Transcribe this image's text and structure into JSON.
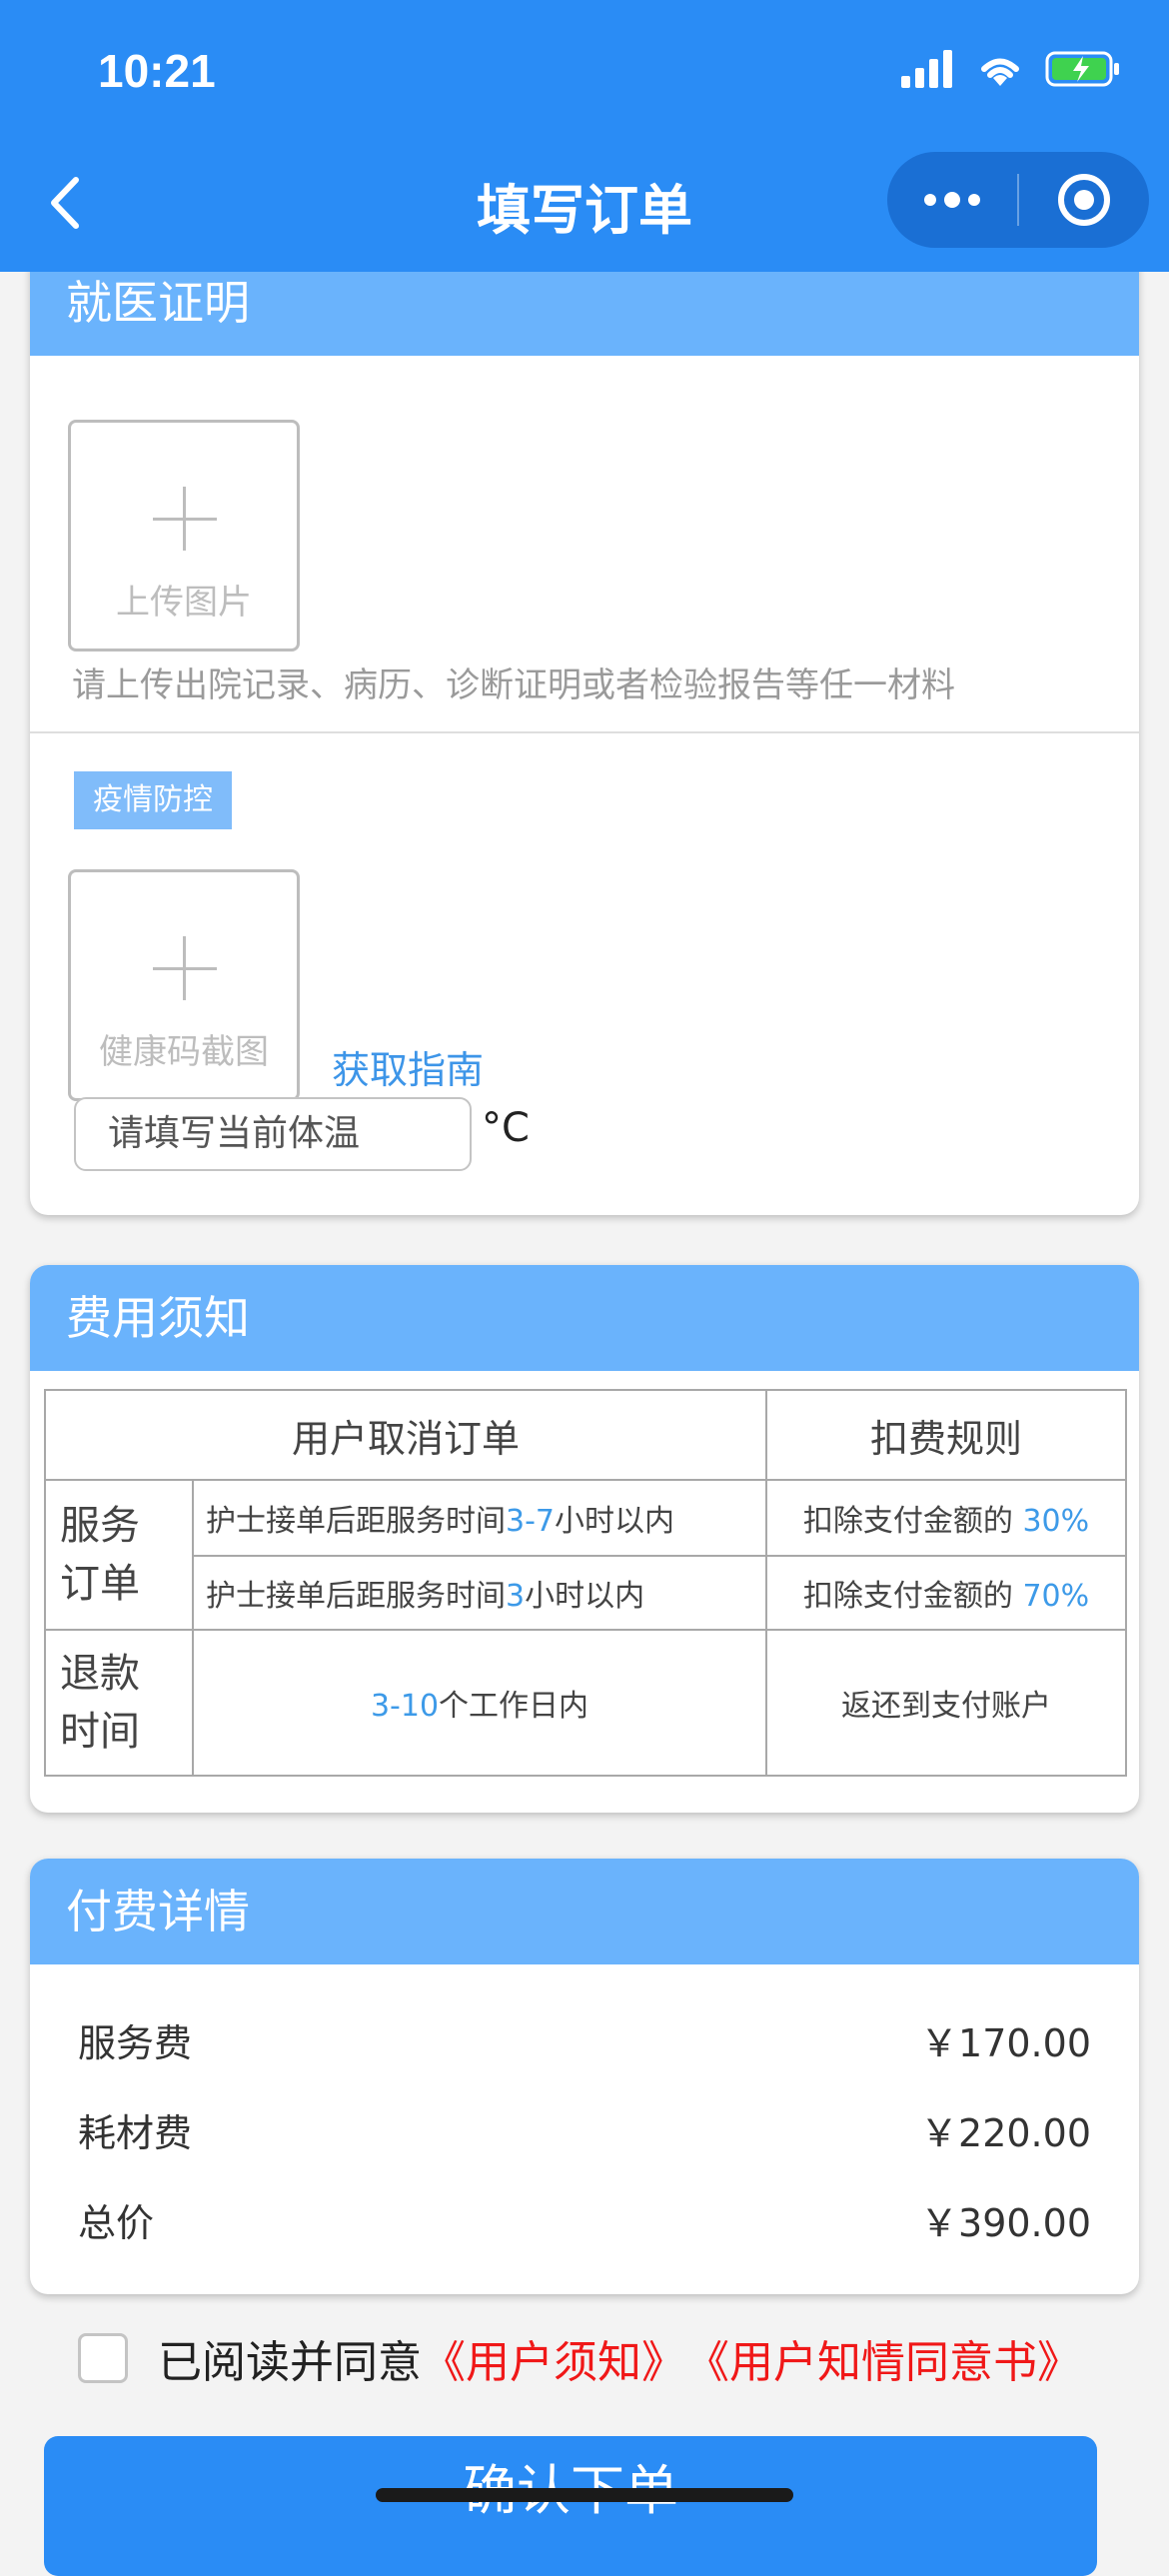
{
  "status_bar": {
    "time": "10:21"
  },
  "nav": {
    "title": "填写订单"
  },
  "medical_proof": {
    "title": "就医证明",
    "upload_label": "上传图片",
    "hint": "请上传出院记录、病历、诊断证明或者检验报告等任一材料",
    "epidemic_tag": "疫情防控",
    "health_code_label": "健康码截图",
    "guide_link": "获取指南",
    "temperature_placeholder": "请填写当前体温",
    "temperature_unit": "°C"
  },
  "fee_notice": {
    "title": "费用须知",
    "header_cancel": "用户取消订单",
    "header_rule": "扣费规则",
    "service_order_label": "服务\n订单",
    "rows": [
      {
        "pre": "护士接单后距服务时间",
        "hl": "3-7",
        "post": "小时以内",
        "rule_pre": "扣除支付金额的 ",
        "rule_hl": "30%"
      },
      {
        "pre": "护士接单后距服务时间",
        "hl": "3",
        "post": "小时以内",
        "rule_pre": "扣除支付金额的 ",
        "rule_hl": "70%"
      }
    ],
    "refund_label": "退款\n时间",
    "refund_hl": "3-10",
    "refund_post": "个工作日内",
    "refund_rule": "返还到支付账户"
  },
  "payment": {
    "title": "付费详情",
    "items": [
      {
        "label": "服务费",
        "value": "￥170.00"
      },
      {
        "label": "耗材费",
        "value": "￥220.00"
      },
      {
        "label": "总价",
        "value": "￥390.00"
      }
    ]
  },
  "agreement": {
    "text": "已阅读并同意",
    "link1": "《用户须知》",
    "link2": "《用户知情同意书》"
  },
  "confirm_button": "确认下单"
}
